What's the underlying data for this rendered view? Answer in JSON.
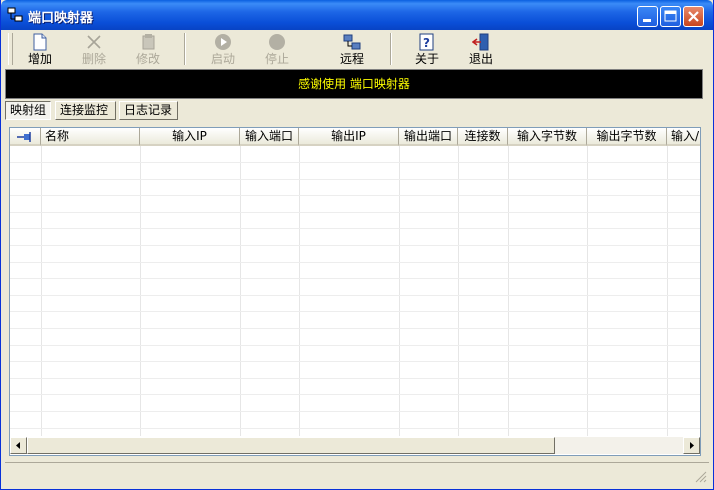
{
  "window": {
    "title": "端口映射器"
  },
  "toolbar": {
    "add": "增加",
    "delete": "删除",
    "edit": "修改",
    "start": "启动",
    "stop": "停止",
    "remote": "远程",
    "about": "关于",
    "exit": "退出"
  },
  "banner": {
    "text": "感谢使用 端口映射器"
  },
  "tabs": [
    {
      "label": "映射组"
    },
    {
      "label": "连接监控"
    },
    {
      "label": "日志记录"
    }
  ],
  "table": {
    "columns": [
      "",
      "名称",
      "输入IP",
      "输入端口",
      "输出IP",
      "输出端口",
      "连接数",
      "输入字节数",
      "输出字节数",
      "输入/"
    ]
  },
  "colors": {
    "banner_text": "#FFFF00",
    "title_bar": "#0A4FD8"
  }
}
